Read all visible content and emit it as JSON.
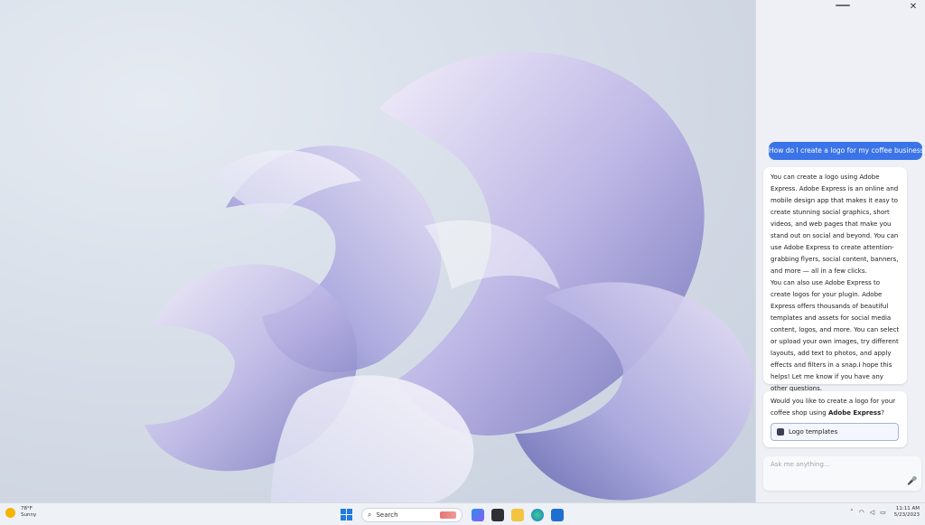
{
  "copilot": {
    "close_label": "✕",
    "user_message": "How do I create a logo for my coffee business?",
    "response_p1": "You can create a logo using Adobe Express. Adobe Express is an online and mobile design app that makes it easy to create stunning social graphics, short videos, and web pages that make you stand out on social and beyond. You can use Adobe Express to create attention-grabbing flyers, social content, banners, and more — all in a few clicks.",
    "response_p2": "You can also use Adobe Express to create logos for your plugin. Adobe Express offers thousands of beautiful templates and assets for social media content, logos, and more. You can select or upload your own images, try different layouts, add text to photos, and apply effects and filters in a snap.I hope this helps! Let me know if you have any other questions.",
    "followup_prefix": "Would you like to create a logo for your coffee shop using ",
    "followup_bold": "Adobe Express",
    "followup_suffix": "?",
    "suggestion_label": "Logo templates",
    "input_placeholder": "Ask me anything..."
  },
  "taskbar": {
    "weather_temp": "78°F",
    "weather_condition": "Sunny",
    "search_placeholder": "Search",
    "clock_time": "11:11 AM",
    "clock_date": "5/23/2023",
    "icons": [
      "start-icon",
      "search-icon",
      "copilot-icon",
      "task-view-icon",
      "file-explorer-icon",
      "edge-icon",
      "store-icon"
    ]
  },
  "colors": {
    "accent": "#3b74e8",
    "panel_bg": "#eef0f5",
    "wallpaper_petal": "#b9b4e0"
  }
}
